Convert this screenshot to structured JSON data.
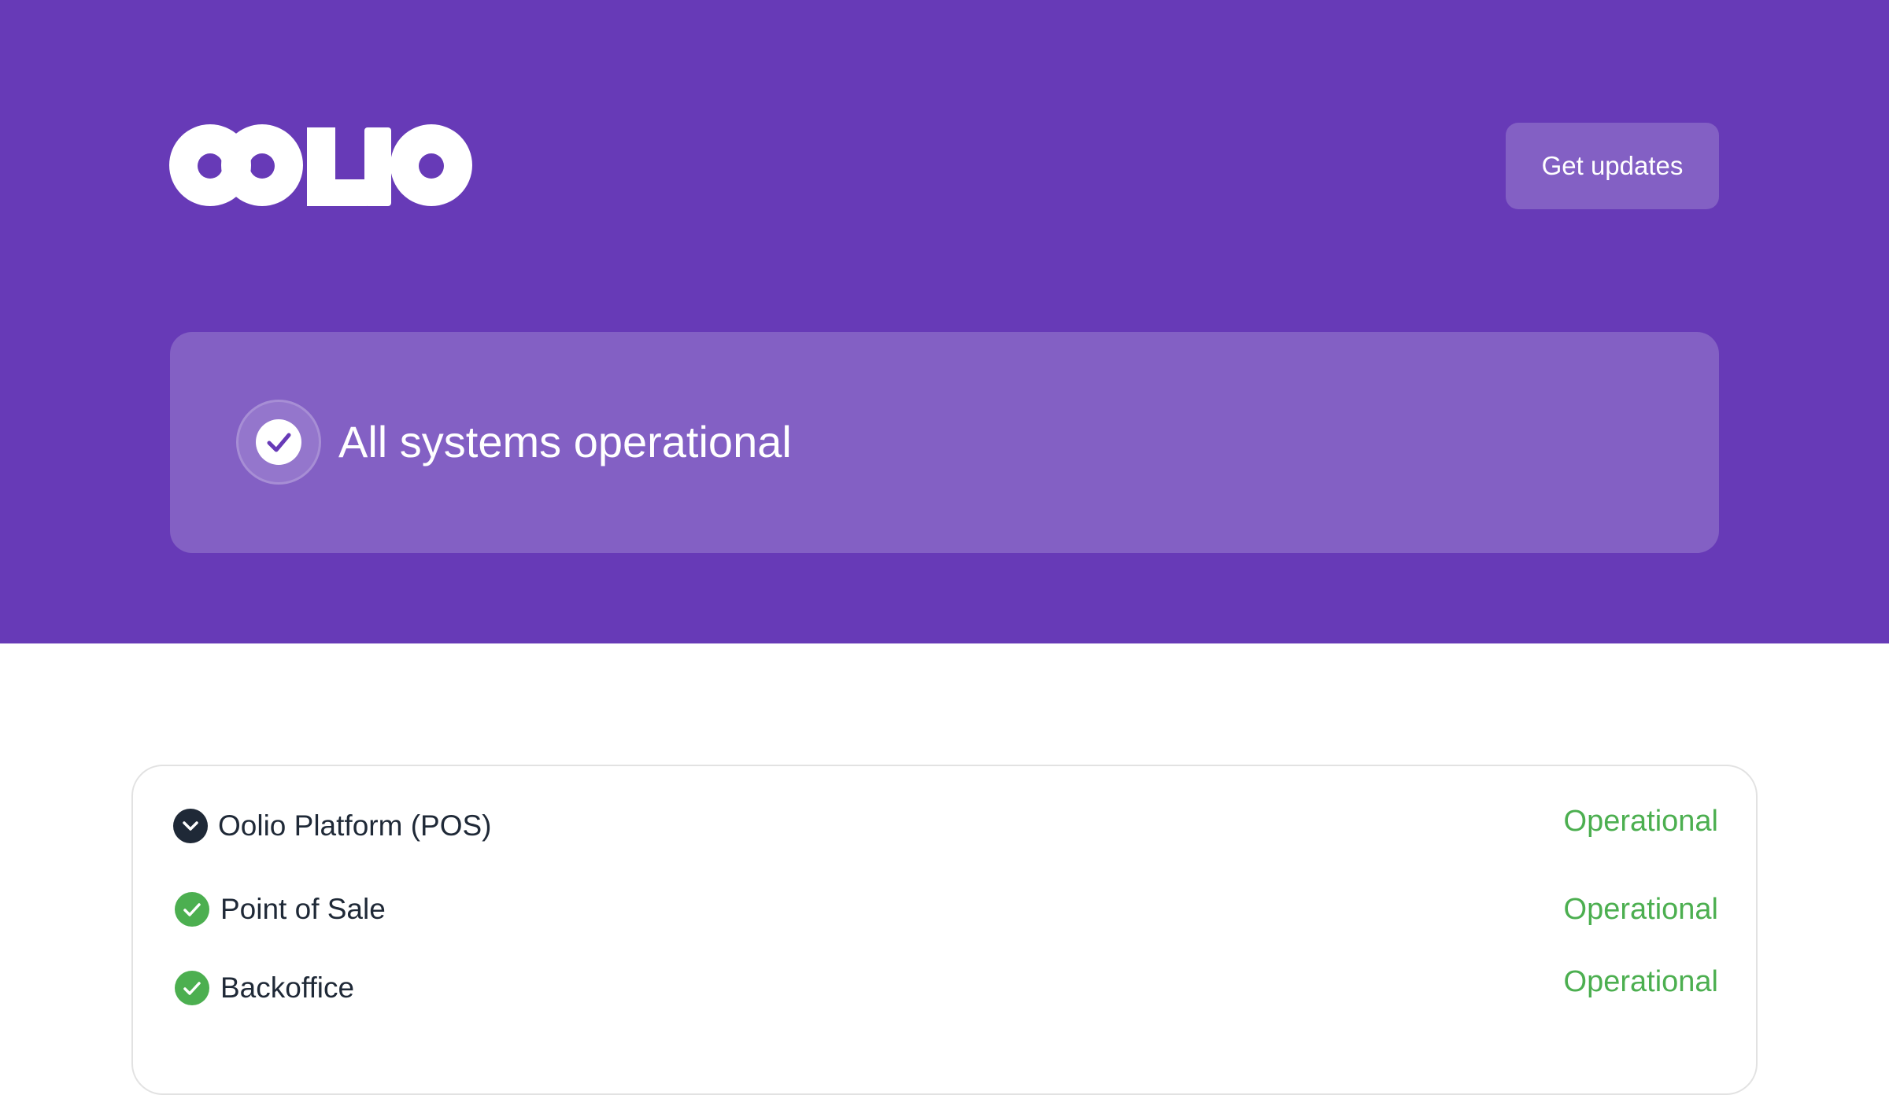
{
  "header": {
    "logo_text": "OOLIO",
    "get_updates_label": "Get updates"
  },
  "overall_status": {
    "text": "All systems operational"
  },
  "components": [
    {
      "name": "Oolio Platform (POS)",
      "status": "Operational",
      "icon": "chevron-down-icon"
    },
    {
      "name": "Point of Sale",
      "status": "Operational",
      "icon": "check-circle-icon"
    },
    {
      "name": "Backoffice",
      "status": "Operational",
      "icon": "check-circle-icon"
    }
  ],
  "colors": {
    "brand": "#673ab7",
    "card": "#8360c4",
    "operational": "#4caf50",
    "group_icon": "#1f2937"
  }
}
